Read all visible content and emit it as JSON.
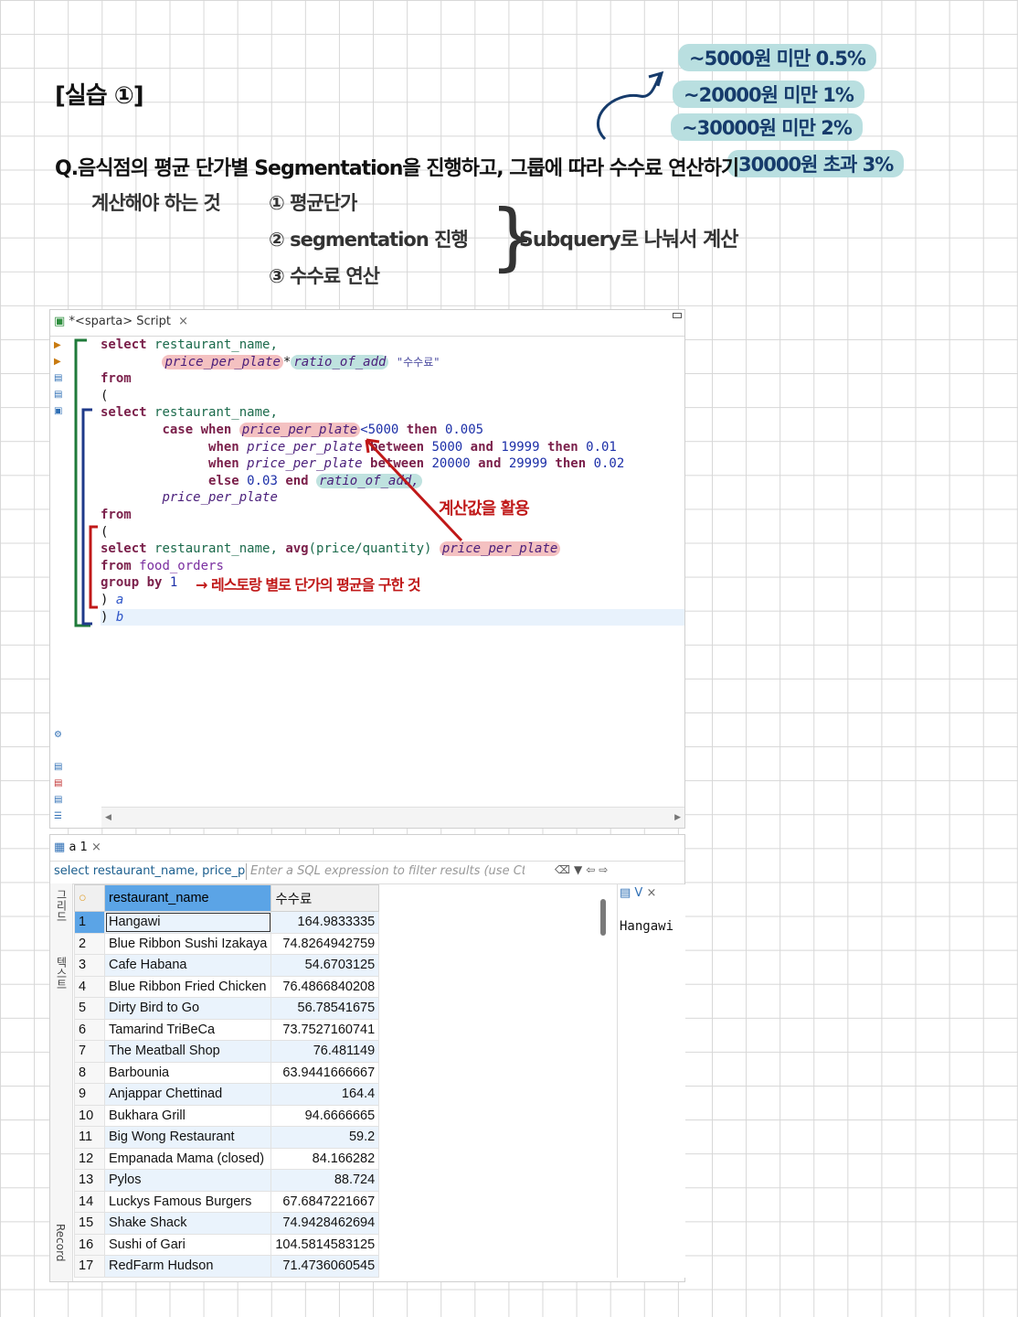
{
  "notes": {
    "title": "[실습 ①]",
    "question": "Q.음식점의 평균 단가별 Segmentation을 진행하고, 그룹에 따라 수수료 연산하기",
    "todo_label": "계산해야 하는 것",
    "todo_items": [
      "① 평균단가",
      "② segmentation 진행",
      "③ 수수료 연산"
    ],
    "subquery_note": "Subquery로 나눠서 계산",
    "tiers": [
      "~5000원 미만 0.5%",
      "~20000원 미만 1%",
      "~30000원 미만 2%",
      "30000원 초과 3%"
    ],
    "calc_note": "계산값을 활용",
    "group_note": "→ 레스토랑 별로 단가의 평균을 구한 것"
  },
  "editor": {
    "tab_title": "*<sparta> Script",
    "tab_close": "×",
    "code": {
      "l1_kw": "select",
      "l1_id": "restaurant_name,",
      "l2_a": "price_per_plate",
      "l2_op": "*",
      "l2_b": "ratio_of_add",
      "l2_str": "\"수수료\"",
      "l3_kw": "from",
      "l4": "(",
      "l5_kw": "select",
      "l5_id": "restaurant_name,",
      "l6_case": "case",
      "l6_when": "when",
      "l6_col": "price_per_plate",
      "l6_op": "<5000",
      "l6_then": "then",
      "l6_val": "0.005",
      "l7_when": "when",
      "l7_col": "price_per_plate",
      "l7_btw": "between",
      "l7_a": "5000",
      "l7_and": "and",
      "l7_b": "19999",
      "l7_then": "then",
      "l7_val": "0.01",
      "l8_when": "when",
      "l8_col": "price_per_plate",
      "l8_btw": "between",
      "l8_a": "20000",
      "l8_and": "and",
      "l8_b": "29999",
      "l8_then": "then",
      "l8_val": "0.02",
      "l9_else": "else",
      "l9_val": "0.03",
      "l9_end": "end",
      "l9_alias": "ratio_of_add,",
      "l10": "price_per_plate",
      "l11_kw": "from",
      "l12": "(",
      "l13_kw": "select",
      "l13_id": "restaurant_name,",
      "l13_fn": "avg",
      "l13_args": "(price/quantity)",
      "l13_alias": "price_per_plate",
      "l14_kw": "from",
      "l14_tbl": "food_orders",
      "l15_kw": "group by",
      "l15_num": "1",
      "l16": ")",
      "l16_alias": "a",
      "l17": ")",
      "l17_alias": "b"
    }
  },
  "results": {
    "tab_label": "a 1",
    "tab_close": "×",
    "query_preview": "select restaurant_name, price_per_plate*ratio_of_add",
    "filter_placeholder": "Enter a SQL expression to filter results (use Ctrl+Space)",
    "side_grid_label": "그리드",
    "side_text_label": "텍스트",
    "side_record_label": "Record",
    "columns": [
      "restaurant_name",
      "수수료"
    ],
    "rows": [
      [
        "1",
        "Hangawi",
        "164.9833335"
      ],
      [
        "2",
        "Blue Ribbon Sushi Izakaya",
        "74.8264942759"
      ],
      [
        "3",
        "Cafe Habana",
        "54.6703125"
      ],
      [
        "4",
        "Blue Ribbon Fried Chicken",
        "76.4866840208"
      ],
      [
        "5",
        "Dirty Bird to Go",
        "56.78541675"
      ],
      [
        "6",
        "Tamarind TriBeCa",
        "73.7527160741"
      ],
      [
        "7",
        "The Meatball Shop",
        "76.481149"
      ],
      [
        "8",
        "Barbounia",
        "63.9441666667"
      ],
      [
        "9",
        "Anjappar Chettinad",
        "164.4"
      ],
      [
        "10",
        "Bukhara Grill",
        "94.6666665"
      ],
      [
        "11",
        "Big Wong Restaurant",
        "59.2"
      ],
      [
        "12",
        "Empanada Mama (closed)",
        "84.166282"
      ],
      [
        "13",
        "Pylos",
        "88.724"
      ],
      [
        "14",
        "Luckys Famous Burgers",
        "67.6847221667"
      ],
      [
        "15",
        "Shake Shack",
        "74.9428462694"
      ],
      [
        "16",
        "Sushi of Gari",
        "104.5814583125"
      ],
      [
        "17",
        "RedFarm Hudson",
        "71.4736060545"
      ]
    ],
    "value_panel_title": "V",
    "value_panel_value": "Hangawi"
  }
}
